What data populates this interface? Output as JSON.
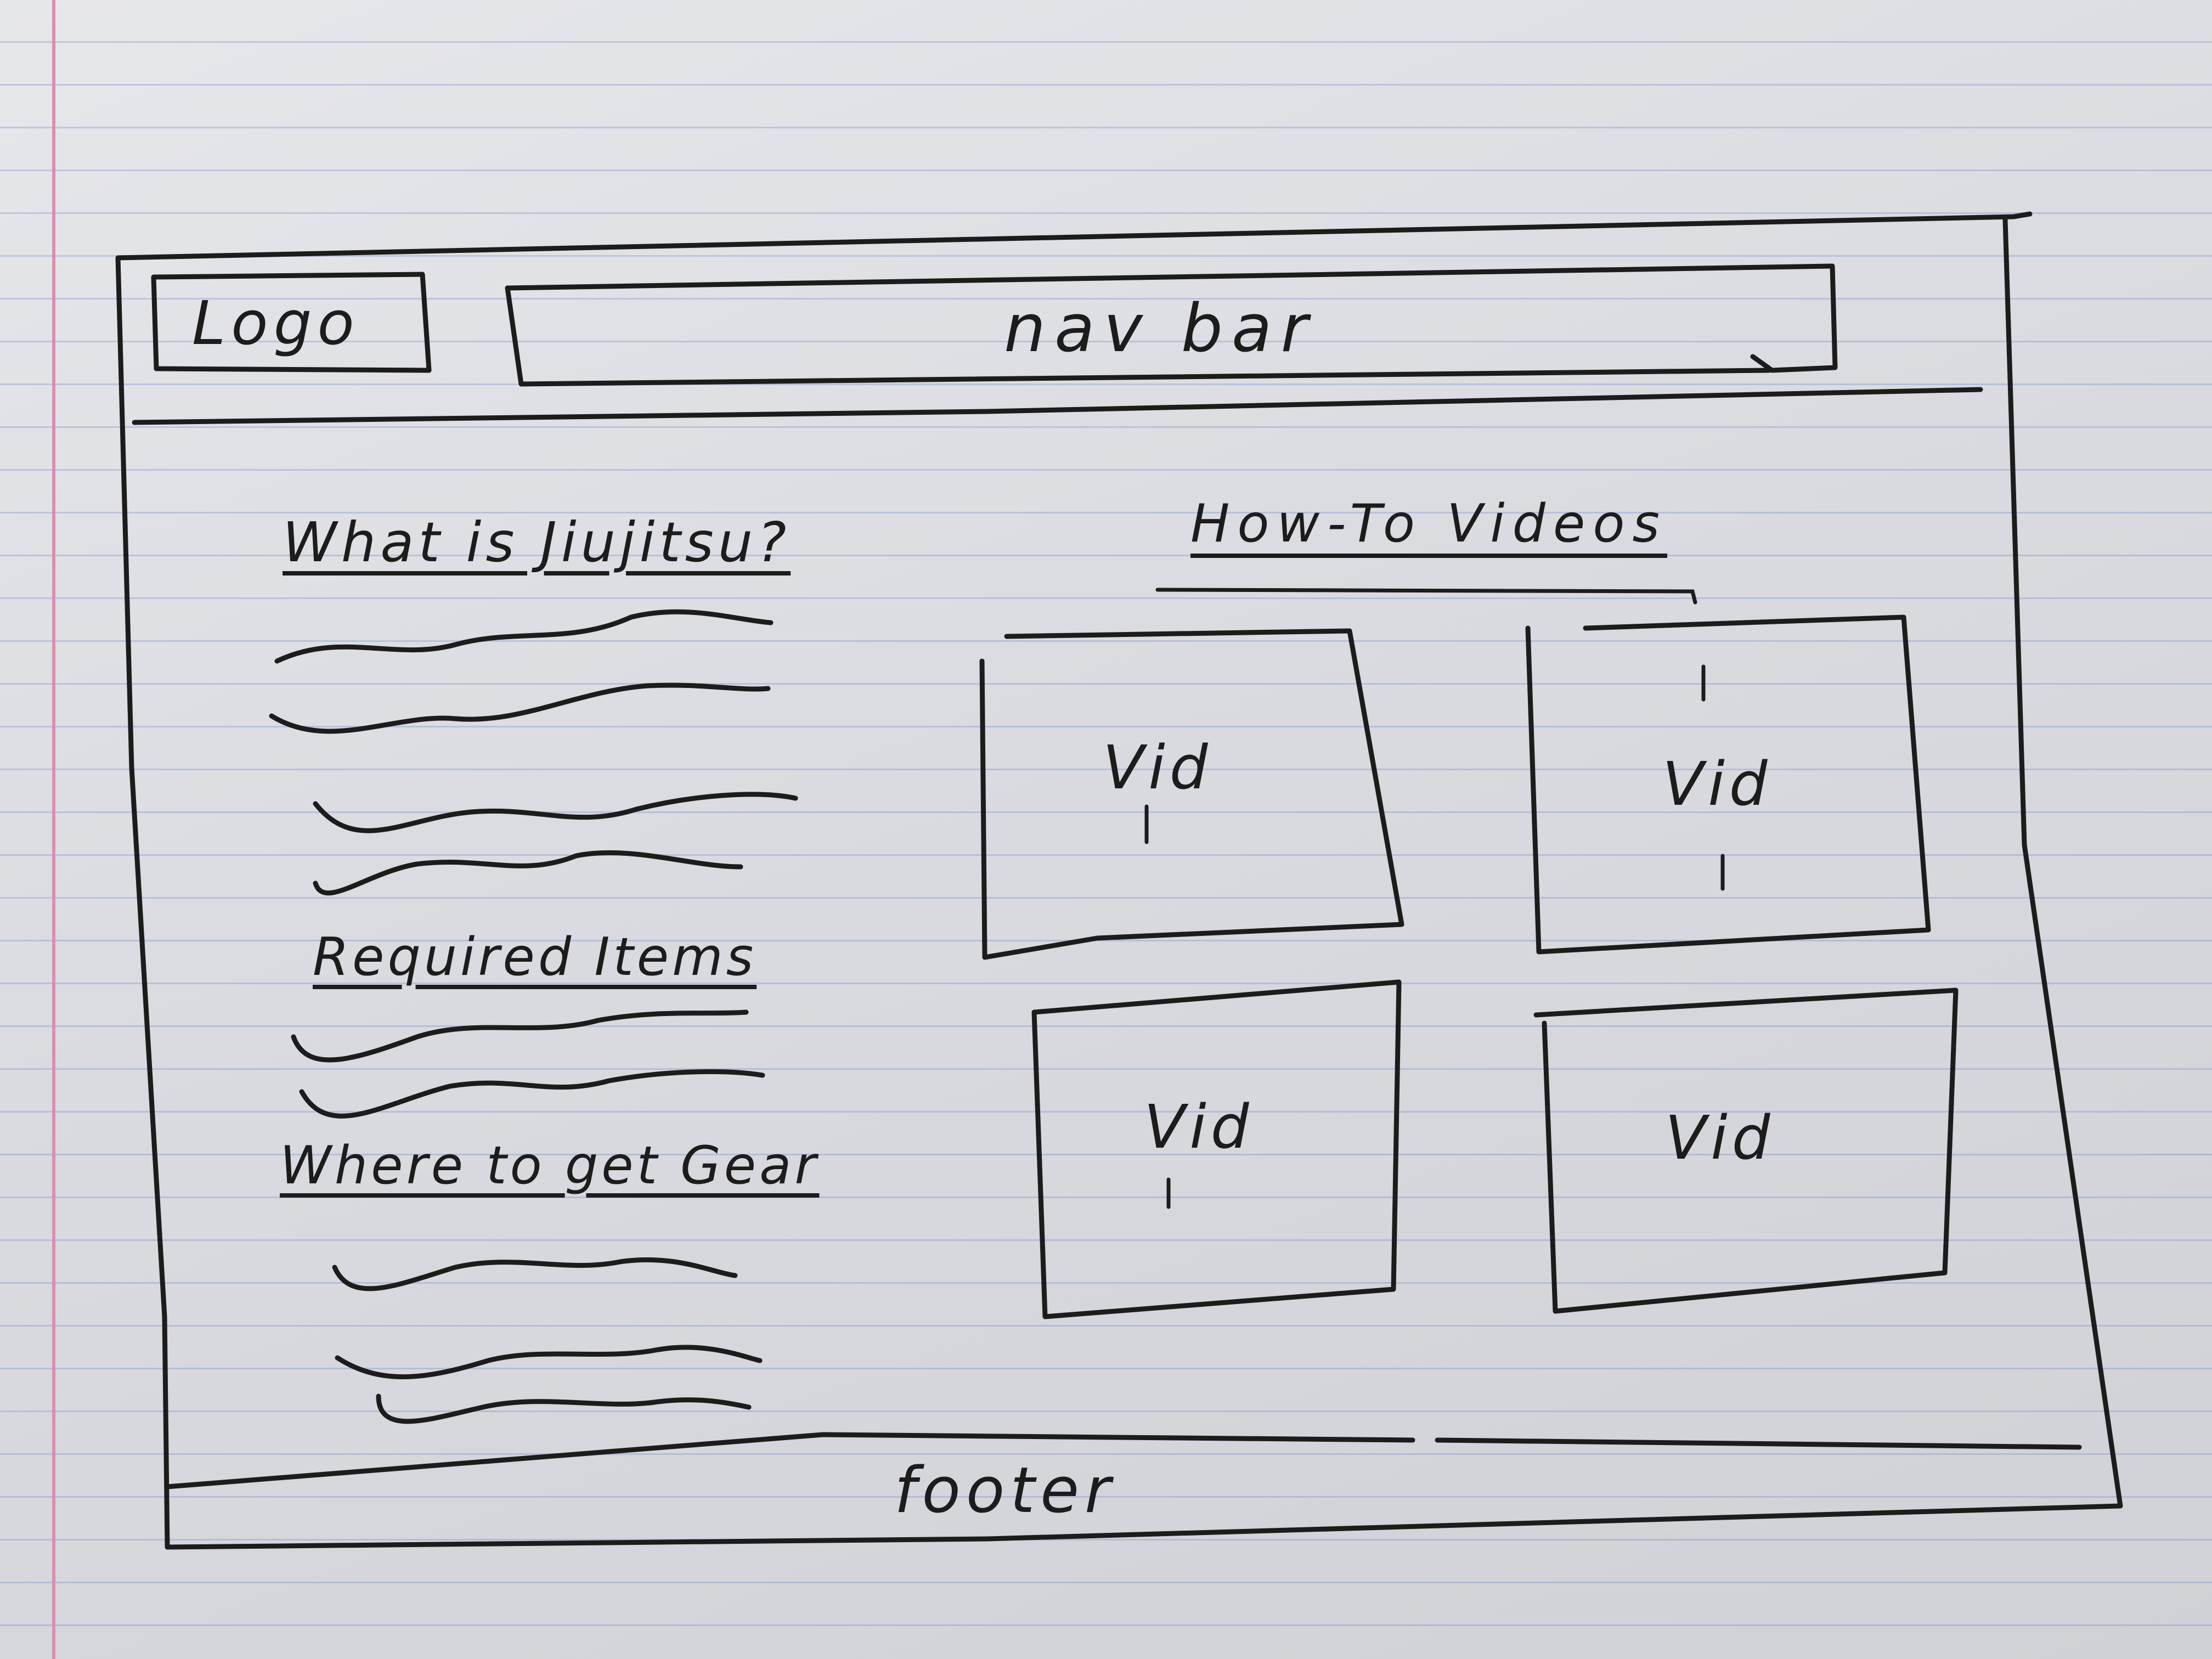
{
  "sketch": {
    "header": {
      "logo_label": "Logo",
      "nav_label": "nav bar"
    },
    "left_column": {
      "sections": [
        {
          "heading": "What is Jiujitsu?"
        },
        {
          "heading": "Required Items"
        },
        {
          "heading": "Where to get Gear"
        }
      ]
    },
    "videos": {
      "heading": "How-To Videos",
      "items": [
        {
          "label": "Vid"
        },
        {
          "label": "Vid"
        },
        {
          "label": "Vid"
        },
        {
          "label": "Vid"
        }
      ]
    },
    "footer": {
      "label": "footer"
    }
  },
  "colors": {
    "paper": "#dcdee3",
    "ink": "#1c1c1c",
    "margin_line": "#d98fb0",
    "rule_lines": "#8c9bd0"
  }
}
